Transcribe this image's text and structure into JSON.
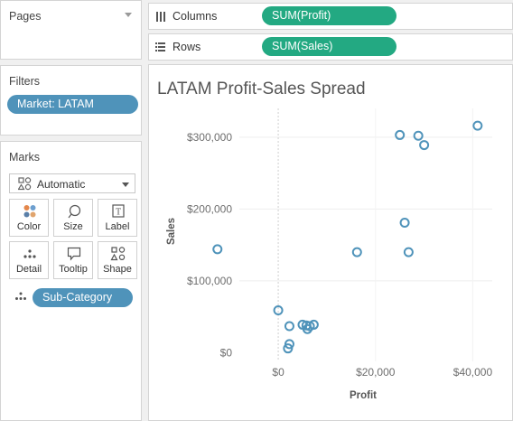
{
  "pages": {
    "title": "Pages"
  },
  "filters": {
    "title": "Filters",
    "pill": "Market: LATAM"
  },
  "marks": {
    "title": "Marks",
    "type": "Automatic",
    "buttons": {
      "color": "Color",
      "size": "Size",
      "label": "Label",
      "detail": "Detail",
      "tooltip": "Tooltip",
      "shape": "Shape"
    },
    "detail_pill": "Sub-Category"
  },
  "shelves": {
    "columns": {
      "label": "Columns",
      "pill": "SUM(Profit)"
    },
    "rows": {
      "label": "Rows",
      "pill": "SUM(Sales)"
    }
  },
  "colors": {
    "filter_pill": "#4f93ba",
    "measure_pill": "#23a982",
    "mark": "#4f93ba"
  },
  "chart_data": {
    "type": "scatter",
    "title": "LATAM Profit-Sales Spread",
    "xlabel": "Profit",
    "ylabel": "Sales",
    "xlim": [
      -8000,
      44000
    ],
    "ylim": [
      -12000,
      340000
    ],
    "xticks": [
      {
        "value": 0,
        "label": "$0"
      },
      {
        "value": 20000,
        "label": "$20,000"
      },
      {
        "value": 40000,
        "label": "$40,000"
      }
    ],
    "yticks": [
      {
        "value": 0,
        "label": "$0"
      },
      {
        "value": 100000,
        "label": "$100,000"
      },
      {
        "value": 200000,
        "label": "$200,000"
      },
      {
        "value": 300000,
        "label": "$300,000"
      }
    ],
    "grid": true,
    "points": [
      {
        "x": 41000,
        "y": 316000
      },
      {
        "x": 25000,
        "y": 303000
      },
      {
        "x": 28800,
        "y": 302000
      },
      {
        "x": 30000,
        "y": 289000
      },
      {
        "x": 26000,
        "y": 181000
      },
      {
        "x": -12500,
        "y": 144000
      },
      {
        "x": 16200,
        "y": 140000
      },
      {
        "x": 26800,
        "y": 140000
      },
      {
        "x": 0,
        "y": 59000
      },
      {
        "x": 2300,
        "y": 37000
      },
      {
        "x": 5000,
        "y": 39000
      },
      {
        "x": 5800,
        "y": 38000
      },
      {
        "x": 6500,
        "y": 37000
      },
      {
        "x": 7300,
        "y": 39000
      },
      {
        "x": 6000,
        "y": 33000
      },
      {
        "x": 2300,
        "y": 12000
      },
      {
        "x": 2000,
        "y": 6000
      }
    ]
  }
}
